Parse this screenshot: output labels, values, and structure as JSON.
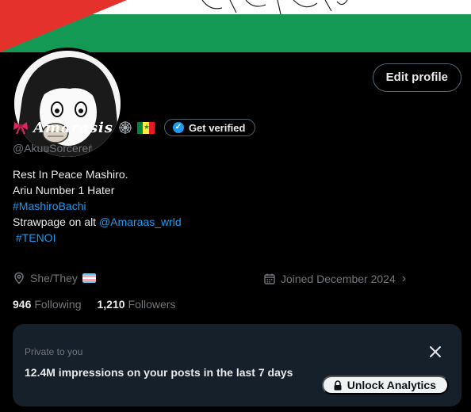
{
  "profile": {
    "display_name": "Amarasis",
    "handle": "@AkuuSorcerer",
    "edit_label": "Edit profile",
    "verify_label": "Get verified",
    "bio": {
      "line1": "Rest In Peace Mashiro.",
      "line2": "Ariu Number 1 Hater",
      "hashtag1": "#MashiroBachi",
      "line4_prefix": "Strawpage on alt ",
      "mention": "@Amaraas_wrld",
      "hashtag2": " #TENOI"
    },
    "pronouns": "She/They",
    "joined": "Joined December 2024",
    "following_count": "946",
    "following_label": "Following",
    "followers_count": "1,210",
    "followers_label": "Followers"
  },
  "analytics": {
    "private_label": "Private to you",
    "impressions_text": "12.4M impressions on your posts in the last 7 days",
    "unlock_label": "Unlock Analytics"
  },
  "icons": {
    "name_prefix": "ribbon-bow-icon",
    "name_suffix": [
      "spider-web-icon",
      "senegal-flag-icon"
    ],
    "verified": "verified-check-icon",
    "location": "location-pin-icon",
    "pronoun_flag": "transgender-flag-icon",
    "calendar": "calendar-icon",
    "chevron": "chevron-right-icon",
    "close": "close-icon",
    "lock": "lock-icon"
  },
  "colors": {
    "accent": "#1d9bf0",
    "background": "#000000",
    "card": "#16202a",
    "muted": "#71767b",
    "text": "#e7e9ea",
    "banner_green": "#149954",
    "banner_red": "#e4312b"
  }
}
